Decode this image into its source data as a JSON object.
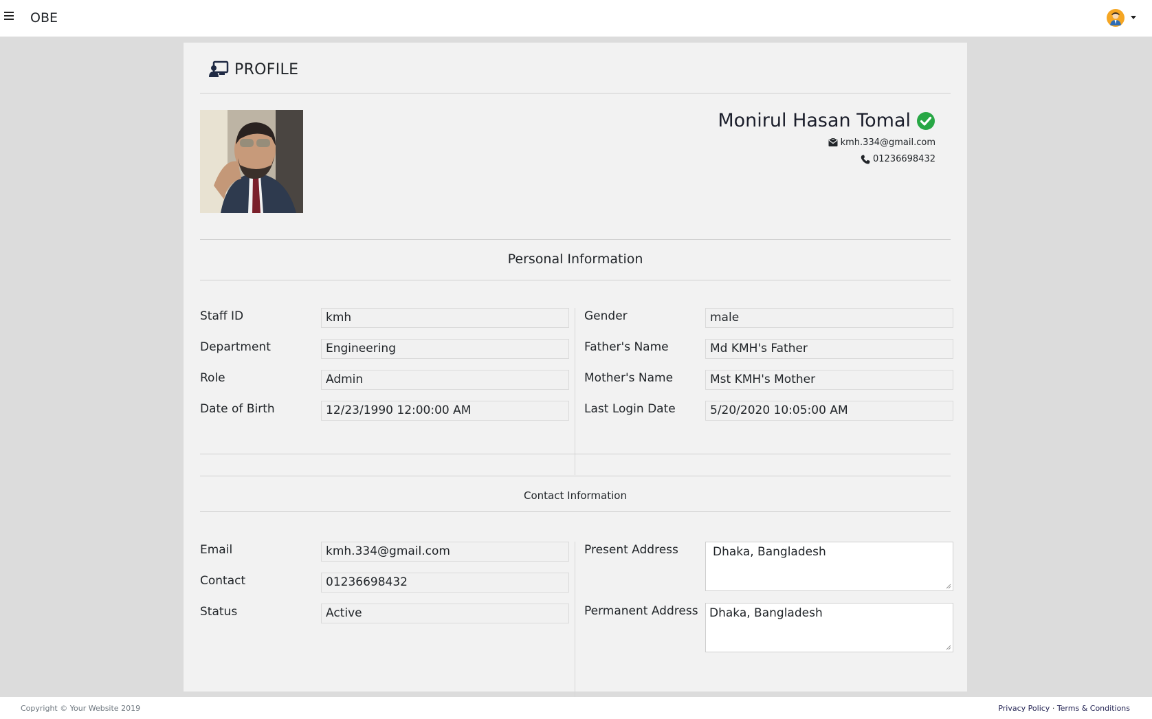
{
  "app": {
    "brand": "OBE"
  },
  "page": {
    "title": "PROFILE"
  },
  "profile": {
    "name": "Monirul Hasan Tomal",
    "email": "kmh.334@gmail.com",
    "phone": "01236698432"
  },
  "personal": {
    "section_title": "Personal Information",
    "left": [
      {
        "label": "Staff ID",
        "value": "kmh"
      },
      {
        "label": "Department",
        "value": "Engineering"
      },
      {
        "label": "Role",
        "value": "Admin"
      },
      {
        "label": "Date of Birth",
        "value": "12/23/1990 12:00:00 AM"
      }
    ],
    "right": [
      {
        "label": "Gender",
        "value": "male"
      },
      {
        "label": "Father's Name",
        "value": "Md KMH's Father"
      },
      {
        "label": "Mother's Name",
        "value": "Mst KMH's Mother"
      },
      {
        "label": "Last Login Date",
        "value": "5/20/2020 10:05:00 AM"
      }
    ]
  },
  "contact": {
    "section_title": "Contact Information",
    "left": [
      {
        "label": "Email",
        "value": "kmh.334@gmail.com"
      },
      {
        "label": "Contact",
        "value": "01236698432"
      },
      {
        "label": "Status",
        "value": "Active"
      }
    ],
    "right": [
      {
        "label": "Present Address",
        "value": "Dhaka, Bangladesh"
      },
      {
        "label": "Permanent Address",
        "value": "Dhaka, Bangladesh"
      }
    ]
  },
  "footer": {
    "copyright": "Copyright © Your Website 2019",
    "privacy": "Privacy Policy",
    "separator": "·",
    "terms": "Terms & Conditions"
  },
  "colors": {
    "page_bg": "#dcdcdc",
    "card_bg": "#f2f2f2",
    "verified_green": "#28a745",
    "avatar_orange": "#f5a623"
  },
  "icons": [
    "menu-icon",
    "user-avatar-icon",
    "profile-card-icon",
    "verified-check-icon",
    "envelope-icon",
    "phone-icon"
  ]
}
